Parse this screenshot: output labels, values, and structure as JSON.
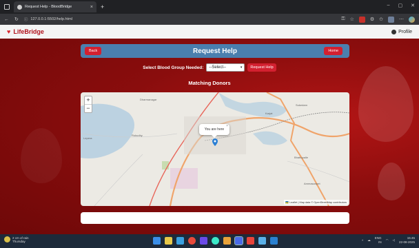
{
  "browser": {
    "tab_title": "Request Help - BloodBridge",
    "tab_close": "×",
    "new_tab": "+",
    "url": "127.0.0.1:5502/help.html",
    "win_min": "–",
    "win_max": "▢",
    "win_close": "✕"
  },
  "navbar": {
    "brand": "LifeBridge",
    "profile": "Profile"
  },
  "header": {
    "title": "Request Help",
    "back_label": "Back",
    "home_label": "Home"
  },
  "form": {
    "label": "Select Blood Group Needed:",
    "select_value": "--Select--",
    "request_label": "Request Help"
  },
  "donors": {
    "heading": "Matching Donors"
  },
  "map": {
    "zoom_in": "+",
    "zoom_out": "−",
    "popup_text": "You are here",
    "popup_close": "×",
    "attribution": "🇺🇦 Leaflet | Map data © OpenStreetMap contributors",
    "places": [
      "Dharmanagar",
      "Karjat",
      "Sukedam",
      "Lepera",
      "Rukudhy",
      "Bhattopalle",
      "Ammasanpet"
    ],
    "colors": {
      "water": "#a8c8e0",
      "road": "#f0a46a",
      "green": "#c8dcb0"
    }
  },
  "taskbar": {
    "weather_line1": "2 cm of rain",
    "weather_line2": "Thursday",
    "lang_line1": "ENG",
    "lang_line2": "IN",
    "time": "15:45",
    "date": "22-08-2025"
  },
  "colors": {
    "accent": "#d32030",
    "header_blue": "#4a7fae",
    "background_red": "#8a0d0d"
  }
}
